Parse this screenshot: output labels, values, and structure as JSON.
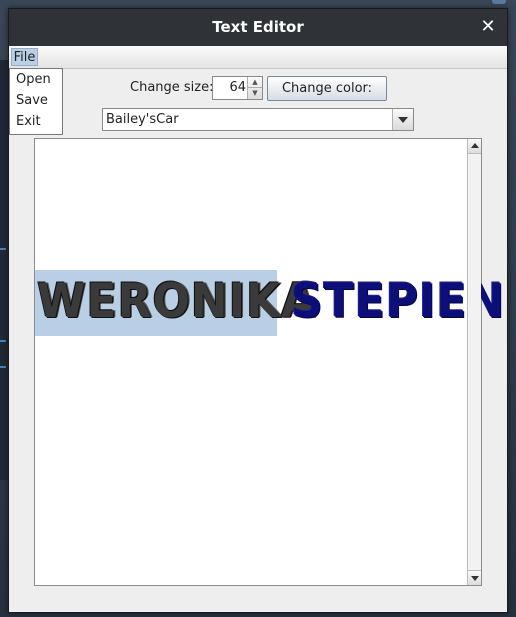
{
  "window": {
    "title": "Text Editor"
  },
  "menu": {
    "file_label": "File",
    "items": [
      {
        "label": "Open"
      },
      {
        "label": "Save"
      },
      {
        "label": "Exit"
      }
    ]
  },
  "toolbar": {
    "size_label": "Change size:",
    "size_value": "64",
    "color_button_label": "Change color:",
    "font_selected": "Bailey'sCar"
  },
  "document": {
    "word1": "WERONIKA",
    "word2": "STEPIEN",
    "word1_color": "#3a3a3a",
    "word2_color": "#0c0f78",
    "selection_color": "#b8cfe5"
  },
  "icons": {
    "close": "close-icon",
    "spinner_up": "chevron-up-icon",
    "spinner_down": "chevron-down-icon",
    "combo_arrow": "chevron-down-icon"
  }
}
